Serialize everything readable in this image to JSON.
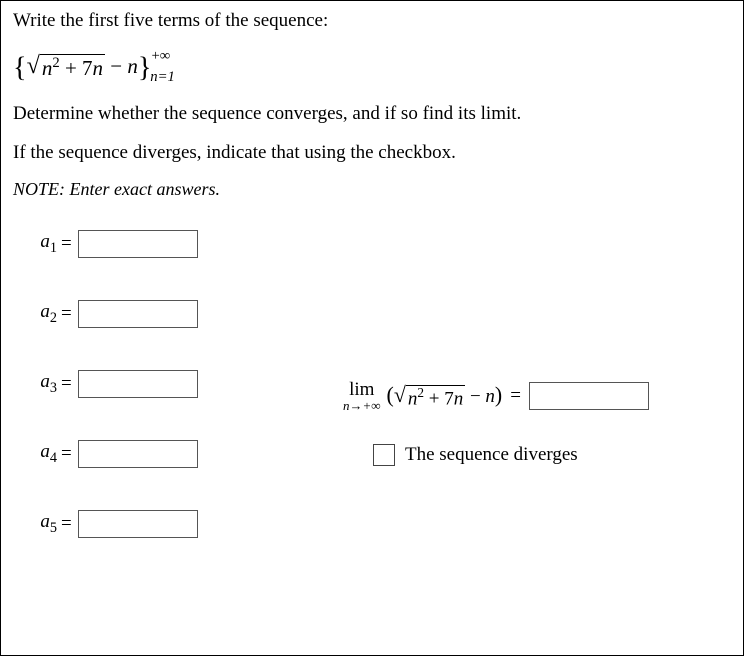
{
  "prompt": {
    "line1": "Write the first five terms of the sequence:",
    "line2": "Determine whether the sequence converges, and if so find its limit.",
    "line3": "If the sequence diverges, indicate that using the checkbox."
  },
  "note": "NOTE:  Enter exact answers.",
  "sequence_formula": {
    "open_brace": "{",
    "sqrt_symbol": "√",
    "radicand_html": "n² + 7n",
    "after_sqrt": " − n",
    "close_brace": "}",
    "super": "+∞",
    "sub": "n=1"
  },
  "terms": [
    {
      "label_base": "a",
      "label_sub": "1",
      "value": ""
    },
    {
      "label_base": "a",
      "label_sub": "2",
      "value": ""
    },
    {
      "label_base": "a",
      "label_sub": "3",
      "value": ""
    },
    {
      "label_base": "a",
      "label_sub": "4",
      "value": ""
    },
    {
      "label_base": "a",
      "label_sub": "5",
      "value": ""
    }
  ],
  "equals": "=",
  "limit": {
    "lim_text": "lim",
    "sub_text": "n→+∞",
    "open_paren": "(",
    "sqrt_symbol": "√",
    "radicand_html": "n² + 7n",
    "after_sqrt": " − n",
    "close_paren": ")",
    "value": ""
  },
  "diverges_label": "The sequence diverges",
  "diverges_checked": false
}
